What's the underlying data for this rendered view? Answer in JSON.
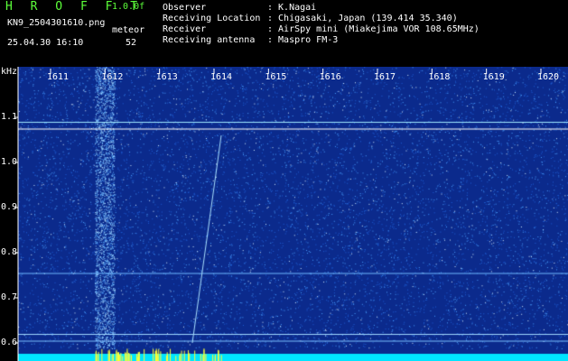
{
  "header": {
    "title": "H R O F F T",
    "version": "1.0.0f",
    "filename": "KN9_2504301610.png",
    "meteor_label": "meteor",
    "datetime": "25.04.30 16:10",
    "meteor_count": "52",
    "info": [
      {
        "label": "Observer",
        "value": ": K.Nagai"
      },
      {
        "label": "Receiving Location",
        "value": ": Chigasaki, Japan (139.414 35.340)"
      },
      {
        "label": "Receiver",
        "value": ": AirSpy mini (Miakejima VOR 108.65MHz)"
      },
      {
        "label": "Receiving antenna",
        "value": ": Maspro FM-3"
      }
    ]
  },
  "chart_data": {
    "type": "heatmap",
    "ylabel": "kHz",
    "y_ticks": [
      "1.1",
      "1.0",
      "0.9",
      "0.8",
      "0.7",
      "0.6"
    ],
    "ylim": [
      0.58,
      1.14
    ],
    "x_ticks": [
      "1611",
      "1612",
      "1613",
      "1614",
      "1615",
      "1616",
      "1617",
      "1618",
      "1619",
      "1620"
    ],
    "xlim": [
      1611,
      1620
    ],
    "colors": {
      "background": "#0b2a8c",
      "noise": "#4aa0ff",
      "signal": "#ffffff",
      "meteor_bar": "#ffff33",
      "baseline": "#00e5ff"
    }
  }
}
